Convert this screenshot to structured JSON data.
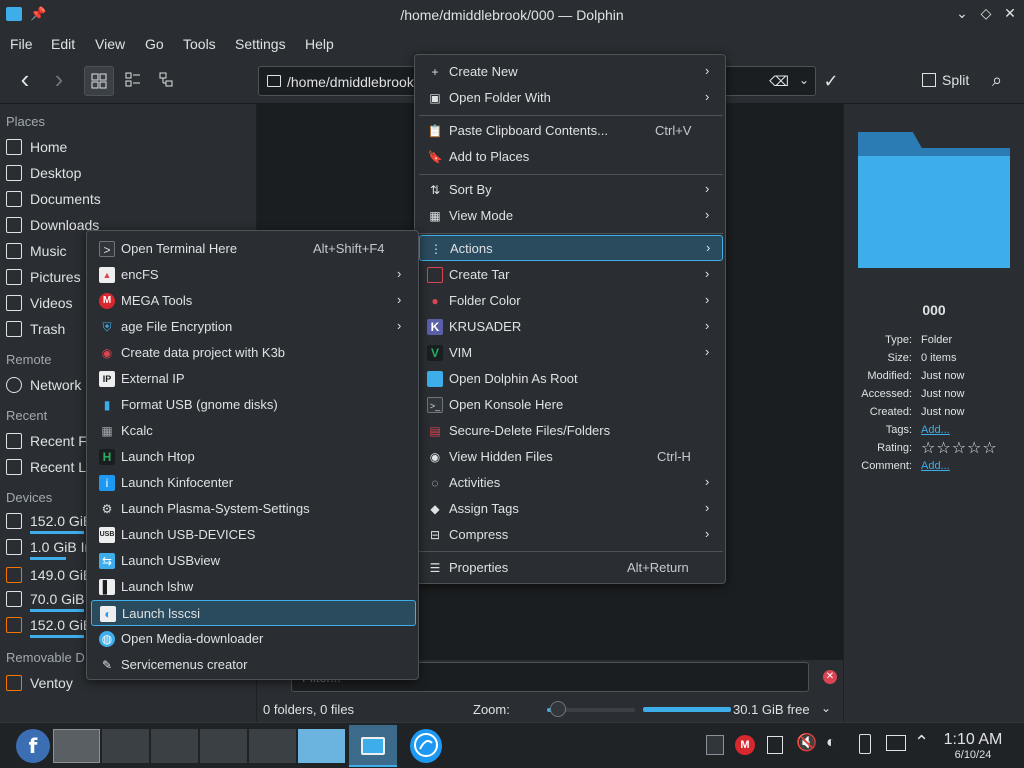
{
  "window": {
    "title": "/home/dmiddlebrook/000 — Dolphin",
    "pin_glyph": "📌",
    "controls": {
      "minimize": "⌄",
      "maximize": "◇",
      "close": "✕"
    }
  },
  "menubar": [
    "File",
    "Edit",
    "View",
    "Go",
    "Tools",
    "Settings",
    "Help"
  ],
  "toolbar": {
    "back_glyph": "‹",
    "forward_glyph": "›",
    "location_text": "/home/dmiddlebrook",
    "clear_glyph": "⌫",
    "dropdown_glyph": "⌄",
    "confirm_glyph": "✓",
    "split_label": "Split",
    "search_glyph": "⌕"
  },
  "sidebar": {
    "sections": {
      "places": "Places",
      "remote": "Remote",
      "recent": "Recent",
      "devices": "Devices",
      "removable": "Removable D"
    },
    "places": [
      "Home",
      "Desktop",
      "Documents",
      "Downloads",
      "Music",
      "Pictures",
      "Videos",
      "Trash"
    ],
    "remote": [
      "Network"
    ],
    "recent": [
      "Recent Fi",
      "Recent Lo"
    ],
    "devices": [
      {
        "label": "152.0 GiB",
        "usage": 0.45
      },
      {
        "label": "1.0 GiB In",
        "usage": 0.3
      },
      {
        "label": "149.0 GiB",
        "usage": 0.0
      },
      {
        "label": "70.0 GiB I",
        "usage": 0.45
      },
      {
        "label": "152.0 GiB",
        "usage": 0.45
      }
    ],
    "removable": [
      "Ventoy"
    ]
  },
  "context_menu": {
    "items": [
      {
        "label": "Create New",
        "submenu": true,
        "icon": "plus-icon",
        "glyph": "+"
      },
      {
        "label": "Open Folder With",
        "submenu": true,
        "icon": "open-with-icon",
        "glyph": "▣"
      },
      {
        "label": "Paste Clipboard Contents...",
        "shortcut": "Ctrl+V",
        "icon": "paste-icon",
        "glyph": "📋"
      },
      {
        "label": "Add to Places",
        "icon": "bookmark-icon",
        "glyph": "🔖"
      },
      {
        "label": "Sort By",
        "submenu": true,
        "icon": "sort-icon",
        "glyph": "⇅"
      },
      {
        "label": "View Mode",
        "submenu": true,
        "icon": "view-mode-icon",
        "glyph": "▦"
      },
      {
        "label": "Actions",
        "submenu": true,
        "icon": "actions-icon",
        "glyph": "⋮"
      },
      {
        "label": "Create Tar",
        "submenu": true,
        "icon": "archive-icon",
        "glyph": "▢"
      },
      {
        "label": "Folder Color",
        "submenu": true,
        "icon": "color-drop-icon",
        "glyph": "💧"
      },
      {
        "label": "KRUSADER",
        "submenu": true,
        "icon": "krusader-icon",
        "glyph": "K"
      },
      {
        "label": "VIM",
        "submenu": true,
        "icon": "vim-icon",
        "glyph": "V"
      },
      {
        "label": "Open Dolphin As Root",
        "icon": "folder-icon",
        "glyph": "▬"
      },
      {
        "label": "Open Konsole Here",
        "icon": "terminal-icon",
        "glyph": ">_"
      },
      {
        "label": "Secure-Delete Files/Folders",
        "icon": "shred-icon",
        "glyph": "🗑"
      },
      {
        "label": "View Hidden Files",
        "shortcut": "Ctrl-H",
        "icon": "eye-icon",
        "glyph": "👁"
      },
      {
        "label": "Activities",
        "submenu": true,
        "icon": "activities-icon",
        "glyph": "◌"
      },
      {
        "label": "Assign Tags",
        "submenu": true,
        "icon": "tag-icon",
        "glyph": "🏷"
      },
      {
        "label": "Compress",
        "submenu": true,
        "icon": "compress-icon",
        "glyph": "⊟"
      },
      {
        "label": "Properties",
        "shortcut": "Alt+Return",
        "icon": "properties-icon",
        "glyph": "☰"
      }
    ]
  },
  "actions_submenu": {
    "items": [
      {
        "label": "Open Terminal Here",
        "shortcut": "Alt+Shift+F4",
        "icon": "terminal-icon",
        "glyph": ">"
      },
      {
        "label": "encFS",
        "submenu": true,
        "icon": "encfs-icon",
        "glyph": "▲"
      },
      {
        "label": "MEGA Tools",
        "submenu": true,
        "icon": "mega-icon",
        "glyph": "M"
      },
      {
        "label": "age File Encryption",
        "submenu": true,
        "icon": "shield-icon",
        "glyph": "⛨"
      },
      {
        "label": "Create data project with K3b",
        "icon": "k3b-icon",
        "glyph": "◉"
      },
      {
        "label": "External IP",
        "icon": "ip-icon",
        "glyph": "IP"
      },
      {
        "label": "Format USB (gnome disks)",
        "icon": "usb-icon",
        "glyph": "▮"
      },
      {
        "label": "Kcalc",
        "icon": "calculator-icon",
        "glyph": "▦"
      },
      {
        "label": "Launch Htop",
        "icon": "htop-icon",
        "glyph": "H"
      },
      {
        "label": "Launch Kinfocenter",
        "icon": "kinfocenter-icon",
        "glyph": "i"
      },
      {
        "label": "Launch Plasma-System-Settings",
        "icon": "settings-icon",
        "glyph": "⚙"
      },
      {
        "label": "Launch USB-DEVICES",
        "icon": "usb-devices-icon",
        "glyph": "USB"
      },
      {
        "label": "Launch USBview",
        "icon": "usbview-icon",
        "glyph": "⇆"
      },
      {
        "label": "Launch lshw",
        "icon": "lshw-icon",
        "glyph": "▌"
      },
      {
        "label": "Launch lsscsi",
        "icon": "lsscsi-icon",
        "glyph": "◐",
        "highlighted": true
      },
      {
        "label": "Open Media-downloader",
        "icon": "media-downloader-icon",
        "glyph": "◍"
      },
      {
        "label": "Servicemenus creator",
        "icon": "servicemenus-icon",
        "glyph": "✎"
      }
    ]
  },
  "main": {
    "filter_placeholder": "Filter...",
    "filter_close_glyph": "✕"
  },
  "info_panel": {
    "name": "000",
    "rows": [
      {
        "key": "Type:",
        "value": "Folder"
      },
      {
        "key": "Size:",
        "value": "0 items"
      },
      {
        "key": "Modified:",
        "value": "Just now"
      },
      {
        "key": "Accessed:",
        "value": "Just now"
      },
      {
        "key": "Created:",
        "value": "Just now"
      },
      {
        "key": "Tags:",
        "value": "Add...",
        "link": true
      },
      {
        "key": "Rating:",
        "value": "☆☆☆☆☆",
        "stars": true
      },
      {
        "key": "Comment:",
        "value": "Add...",
        "link": true
      }
    ]
  },
  "statusbar": {
    "summary": "0 folders, 0 files",
    "zoom_label": "Zoom:",
    "zoom_level": 0.12,
    "free_space": "30.1 GiB free",
    "dropdown_glyph": "⌄"
  },
  "taskbar": {
    "time": "1:10 AM",
    "date": "6/10/24"
  },
  "colors": {
    "accent": "#3daee9",
    "highlight_bg": "#2a4a5e",
    "window_bg": "#2a2e32",
    "view_bg": "#1b1e20"
  }
}
